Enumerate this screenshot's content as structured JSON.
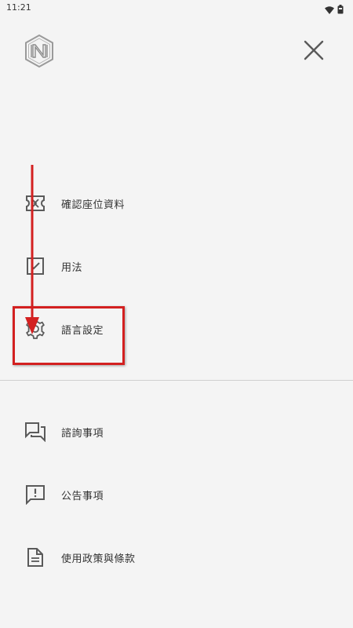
{
  "status_bar": {
    "time": "11:21"
  },
  "header": {
    "logo_icon": "hexagon-n-logo",
    "close_icon": "close-icon"
  },
  "menu": {
    "primary": [
      {
        "label": "確認座位資料",
        "icon": "ticket-icon"
      },
      {
        "label": "用法",
        "icon": "check-square-icon"
      },
      {
        "label": "語言設定",
        "icon": "gear-icon"
      }
    ],
    "secondary": [
      {
        "label": "諮詢事項",
        "icon": "chat-bubbles-icon"
      },
      {
        "label": "公告事項",
        "icon": "alert-message-icon"
      },
      {
        "label": "使用政策與條款",
        "icon": "document-icon"
      }
    ]
  },
  "annotation": {
    "color": "#d32020"
  },
  "colors": {
    "background": "#f4f4f4",
    "icon": "#5a5a5a",
    "text": "#333333"
  }
}
